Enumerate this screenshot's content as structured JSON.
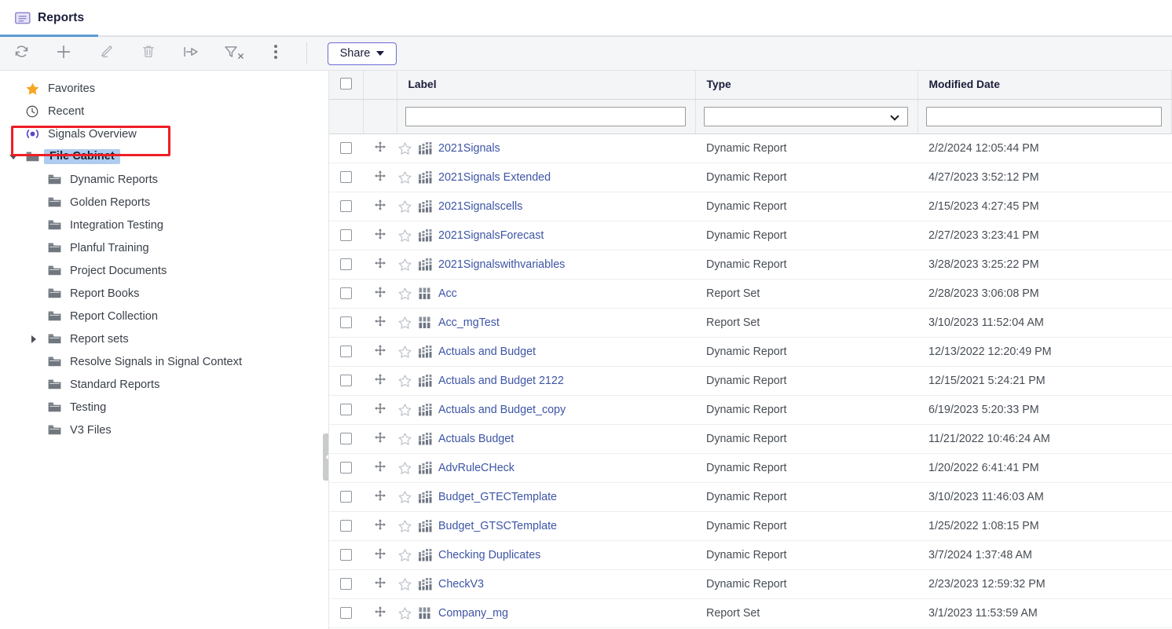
{
  "tab": {
    "title": "Reports",
    "icon": "report-document-icon"
  },
  "toolbar": {
    "buttons": [
      {
        "name": "refresh",
        "icon": "refresh-icon",
        "label": "Refresh"
      },
      {
        "name": "add",
        "icon": "plus-icon",
        "label": "Add"
      },
      {
        "name": "edit",
        "icon": "pencil-icon",
        "label": "Edit"
      },
      {
        "name": "delete",
        "icon": "trash-icon",
        "label": "Delete"
      },
      {
        "name": "move",
        "icon": "move-arrow-icon",
        "label": "Move"
      },
      {
        "name": "clearfilter",
        "icon": "filter-clear-icon",
        "label": "Clear Filter"
      },
      {
        "name": "more",
        "icon": "kebab-menu-icon",
        "label": "More"
      }
    ],
    "share_label": "Share"
  },
  "sidebar": {
    "items": [
      {
        "label": "Favorites",
        "icon": "star-icon",
        "indent": 0,
        "twisty": "none",
        "selected": false,
        "highlighted": false
      },
      {
        "label": "Recent",
        "icon": "clock-icon",
        "indent": 0,
        "twisty": "none",
        "selected": false,
        "highlighted": false
      },
      {
        "label": "Signals Overview",
        "icon": "signal-icon",
        "indent": 0,
        "twisty": "none",
        "selected": false,
        "highlighted": true
      },
      {
        "label": "File Cabinet",
        "icon": "folder-icon",
        "indent": 0,
        "twisty": "open",
        "selected": true,
        "highlighted": false
      },
      {
        "label": "Dynamic Reports",
        "icon": "folder-icon",
        "indent": 1,
        "twisty": "none",
        "selected": false,
        "highlighted": false
      },
      {
        "label": "Golden Reports",
        "icon": "folder-icon",
        "indent": 1,
        "twisty": "none",
        "selected": false,
        "highlighted": false
      },
      {
        "label": "Integration Testing",
        "icon": "folder-icon",
        "indent": 1,
        "twisty": "none",
        "selected": false,
        "highlighted": false
      },
      {
        "label": "Planful Training",
        "icon": "folder-icon",
        "indent": 1,
        "twisty": "none",
        "selected": false,
        "highlighted": false
      },
      {
        "label": "Project Documents",
        "icon": "folder-icon",
        "indent": 1,
        "twisty": "none",
        "selected": false,
        "highlighted": false
      },
      {
        "label": "Report Books",
        "icon": "folder-icon",
        "indent": 1,
        "twisty": "none",
        "selected": false,
        "highlighted": false
      },
      {
        "label": "Report Collection",
        "icon": "folder-icon",
        "indent": 1,
        "twisty": "none",
        "selected": false,
        "highlighted": false
      },
      {
        "label": "Report sets",
        "icon": "folder-icon",
        "indent": 1,
        "twisty": "closed",
        "selected": false,
        "highlighted": false
      },
      {
        "label": "Resolve Signals in Signal Context",
        "icon": "folder-icon",
        "indent": 1,
        "twisty": "none",
        "selected": false,
        "highlighted": false
      },
      {
        "label": "Standard Reports",
        "icon": "folder-icon",
        "indent": 1,
        "twisty": "none",
        "selected": false,
        "highlighted": false
      },
      {
        "label": "Testing",
        "icon": "folder-icon",
        "indent": 1,
        "twisty": "none",
        "selected": false,
        "highlighted": false
      },
      {
        "label": "V3 Files",
        "icon": "folder-icon",
        "indent": 1,
        "twisty": "none",
        "selected": false,
        "highlighted": false
      }
    ],
    "collapse_handle_icon": "chevron-left-icon"
  },
  "grid": {
    "columns": [
      {
        "key": "check",
        "label": ""
      },
      {
        "key": "drag",
        "label": ""
      },
      {
        "key": "label",
        "label": "Label"
      },
      {
        "key": "type",
        "label": "Type"
      },
      {
        "key": "date",
        "label": "Modified Date"
      }
    ],
    "filters": {
      "label_value": "",
      "label_placeholder": "",
      "type_value": "",
      "date_value": "",
      "date_placeholder": ""
    },
    "rows": [
      {
        "label": "2021Signals",
        "type": "Dynamic Report",
        "date": "2/2/2024 12:05:44 PM",
        "icon": "dynamic-report-icon",
        "checked": false,
        "starred": false
      },
      {
        "label": "2021Signals Extended",
        "type": "Dynamic Report",
        "date": "4/27/2023 3:52:12 PM",
        "icon": "dynamic-report-icon",
        "checked": false,
        "starred": false
      },
      {
        "label": "2021Signalscells",
        "type": "Dynamic Report",
        "date": "2/15/2023 4:27:45 PM",
        "icon": "dynamic-report-icon",
        "checked": false,
        "starred": false
      },
      {
        "label": "2021SignalsForecast",
        "type": "Dynamic Report",
        "date": "2/27/2023 3:23:41 PM",
        "icon": "dynamic-report-icon",
        "checked": false,
        "starred": false
      },
      {
        "label": "2021Signalswithvariables",
        "type": "Dynamic Report",
        "date": "3/28/2023 3:25:22 PM",
        "icon": "dynamic-report-icon",
        "checked": false,
        "starred": false
      },
      {
        "label": "Acc",
        "type": "Report Set",
        "date": "2/28/2023 3:06:08 PM",
        "icon": "report-set-icon",
        "checked": false,
        "starred": false
      },
      {
        "label": "Acc_mgTest",
        "type": "Report Set",
        "date": "3/10/2023 11:52:04 AM",
        "icon": "report-set-icon",
        "checked": false,
        "starred": false
      },
      {
        "label": "Actuals and Budget",
        "type": "Dynamic Report",
        "date": "12/13/2022 12:20:49 PM",
        "icon": "dynamic-report-icon",
        "checked": false,
        "starred": false
      },
      {
        "label": "Actuals and Budget 2122",
        "type": "Dynamic Report",
        "date": "12/15/2021 5:24:21 PM",
        "icon": "dynamic-report-icon",
        "checked": false,
        "starred": false
      },
      {
        "label": "Actuals and Budget_copy",
        "type": "Dynamic Report",
        "date": "6/19/2023 5:20:33 PM",
        "icon": "dynamic-report-icon",
        "checked": false,
        "starred": false
      },
      {
        "label": "Actuals Budget",
        "type": "Dynamic Report",
        "date": "11/21/2022 10:46:24 AM",
        "icon": "dynamic-report-icon",
        "checked": false,
        "starred": false
      },
      {
        "label": "AdvRuleCHeck",
        "type": "Dynamic Report",
        "date": "1/20/2022 6:41:41 PM",
        "icon": "dynamic-report-icon",
        "checked": false,
        "starred": false
      },
      {
        "label": "Budget_GTECTemplate",
        "type": "Dynamic Report",
        "date": "3/10/2023 11:46:03 AM",
        "icon": "dynamic-report-icon",
        "checked": false,
        "starred": false
      },
      {
        "label": "Budget_GTSCTemplate",
        "type": "Dynamic Report",
        "date": "1/25/2022 1:08:15 PM",
        "icon": "dynamic-report-icon",
        "checked": false,
        "starred": false
      },
      {
        "label": "Checking Duplicates",
        "type": "Dynamic Report",
        "date": "3/7/2024 1:37:48 AM",
        "icon": "dynamic-report-icon",
        "checked": false,
        "starred": false
      },
      {
        "label": "CheckV3",
        "type": "Dynamic Report",
        "date": "2/23/2023 12:59:32 PM",
        "icon": "dynamic-report-icon",
        "checked": false,
        "starred": false
      },
      {
        "label": "Company_mg",
        "type": "Report Set",
        "date": "3/1/2023 11:53:59 AM",
        "icon": "report-set-icon",
        "checked": false,
        "starred": false
      }
    ]
  },
  "colors": {
    "tab_underline": "#5b9bd5",
    "link": "#3d55a5",
    "selection": "#aecbf0",
    "highlight_border": "#ee1f26",
    "toolbar_bg": "#f5f6f7",
    "header_bg": "#f4f5f6",
    "star_icon": "#f5a623",
    "signal_icon": "#5a45c8"
  }
}
